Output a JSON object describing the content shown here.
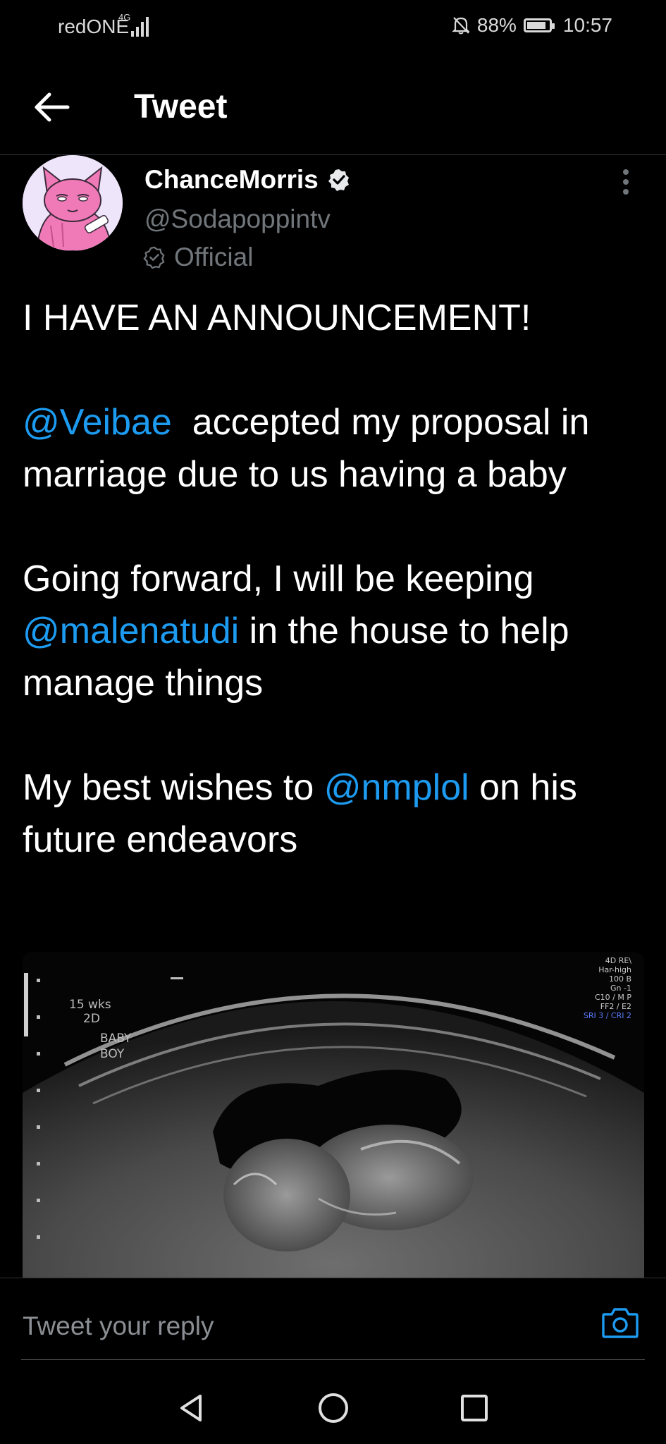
{
  "status_bar": {
    "carrier": "redONE",
    "network": "4G",
    "battery": "88%",
    "battery_level": 0.88,
    "time": "10:57"
  },
  "header": {
    "title": "Tweet"
  },
  "tweet": {
    "display_name": "ChanceMorris",
    "handle": "@Sodapoppintv",
    "label": "Official",
    "text": {
      "line1": "I HAVE AN ANNOUNCEMENT!",
      "mention1": "@Veibae",
      "p2_text": "  accepted my proposal in marriage due to us having a baby",
      "p3_before": "Going forward, I will be keeping ",
      "mention2": "@malenatudi",
      "p3_after": " in the house to help manage things",
      "p4_before": "My best wishes to ",
      "mention3": "@nmplol",
      "p4_after": " on his future endeavors"
    },
    "media": {
      "labels": [
        "15 wks",
        "2D",
        "BABY",
        "BOY"
      ],
      "tech_lines": [
        "4D RE\\",
        "Har-high",
        "100 B",
        "Gn -1",
        "C10 / M P",
        "FF2 / E2",
        "SRI 3 / CRI 2"
      ]
    }
  },
  "reply": {
    "placeholder": "Tweet your reply"
  },
  "icons": {
    "back": "arrow-left-icon",
    "verified": "verified-badge-icon",
    "official": "official-badge-icon",
    "more": "more-vertical-icon",
    "camera": "camera-icon",
    "nav_back": "triangle-back-icon",
    "nav_home": "circle-home-icon",
    "nav_recents": "square-recents-icon"
  },
  "colors": {
    "background": "#000000",
    "mention": "#1d9bf0",
    "secondary_text": "#71767b"
  }
}
